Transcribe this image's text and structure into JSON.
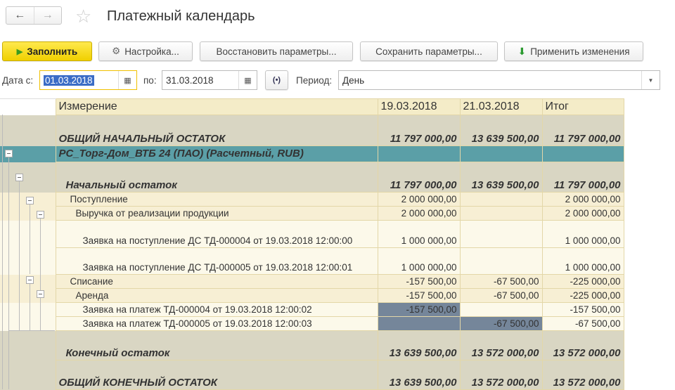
{
  "header": {
    "title": "Платежный календарь",
    "back": "←",
    "forward": "→",
    "favorite": "☆"
  },
  "toolbar": {
    "fill": "Заполнить",
    "settings": "Настройка...",
    "restore": "Восстановить параметры...",
    "save": "Сохранить параметры...",
    "apply": "Применить изменения"
  },
  "filters": {
    "date_from_label": "Дата с:",
    "date_from": "01.03.2018",
    "date_to_label": "по:",
    "date_to": "31.03.2018",
    "period_label": "Период:",
    "period": "День"
  },
  "table": {
    "columns": [
      "Измерение",
      "19.03.2018",
      "21.03.2018",
      "Итог"
    ],
    "rows": [
      {
        "label": "ОБЩИЙ НАЧАЛЬНЫЙ ОСТАТОК",
        "v": [
          "11 797 000,00",
          "13 639 500,00",
          "11 797 000,00"
        ]
      },
      {
        "label": "РС_Торг-Дом_ВТБ 24 (ПАО) (Расчетный, RUB)",
        "v": [
          "",
          "",
          ""
        ]
      },
      {
        "label": "Начальный остаток",
        "v": [
          "11 797 000,00",
          "13 639 500,00",
          "11 797 000,00"
        ]
      },
      {
        "label": "Поступление",
        "v": [
          "2 000 000,00",
          "",
          "2 000 000,00"
        ]
      },
      {
        "label": "Выручка от реализации продукции",
        "v": [
          "2 000 000,00",
          "",
          "2 000 000,00"
        ]
      },
      {
        "label": "Заявка на поступление ДС ТД-000004 от 19.03.2018 12:00:00",
        "v": [
          "1 000 000,00",
          "",
          "1 000 000,00"
        ]
      },
      {
        "label": "Заявка на поступление ДС ТД-000005 от 19.03.2018 12:00:01",
        "v": [
          "1 000 000,00",
          "",
          "1 000 000,00"
        ]
      },
      {
        "label": "Списание",
        "v": [
          "-157 500,00",
          "-67 500,00",
          "-225 000,00"
        ]
      },
      {
        "label": "Аренда",
        "v": [
          "-157 500,00",
          "-67 500,00",
          "-225 000,00"
        ]
      },
      {
        "label": "Заявка на платеж ТД-000004 от 19.03.2018 12:00:02",
        "v": [
          "-157 500,00",
          "",
          "-157 500,00"
        ]
      },
      {
        "label": "Заявка на платеж ТД-000005 от 19.03.2018 12:00:03",
        "v": [
          "",
          "-67 500,00",
          "-67 500,00"
        ]
      },
      {
        "label": "Конечный остаток",
        "v": [
          "13 639 500,00",
          "13 572 000,00",
          "13 572 000,00"
        ]
      },
      {
        "label": "ОБЩИЙ КОНЕЧНЫЙ ОСТАТОК",
        "v": [
          "13 639 500,00",
          "13 572 000,00",
          "13 572 000,00"
        ]
      }
    ]
  },
  "colors": {
    "accent": "#f0d000",
    "bank_row": "#5b9fa7",
    "highlight": "#75869a"
  }
}
